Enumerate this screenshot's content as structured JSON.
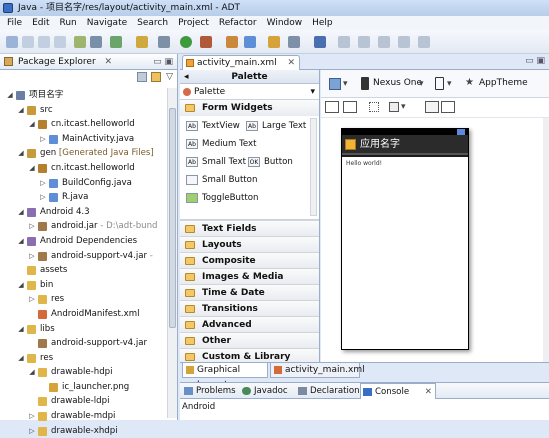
{
  "window": {
    "title": "Java - 项目名字/res/layout/activity_main.xml - ADT"
  },
  "menu": [
    "File",
    "Edit",
    "Run",
    "Navigate",
    "Search",
    "Project",
    "Refactor",
    "Window",
    "Help"
  ],
  "left": {
    "tab_label": "Package Explorer",
    "tree": [
      {
        "label": "项目名字",
        "indent": 0,
        "arrow": "◢",
        "icon": "project-icon",
        "color": "#6b7fa3"
      },
      {
        "label": "src",
        "indent": 1,
        "arrow": "◢",
        "icon": "src-folder-icon",
        "color": "#c79a3a"
      },
      {
        "label": "cn.itcast.helloworld",
        "indent": 2,
        "arrow": "◢",
        "icon": "package-icon",
        "color": "#b67f2e"
      },
      {
        "label": "MainActivity.java",
        "indent": 3,
        "arrow": "▷",
        "icon": "java-file-icon",
        "color": "#5e8ed6"
      },
      {
        "label": "gen",
        "suffix": " [Generated Java Files]",
        "indent": 1,
        "arrow": "◢",
        "icon": "gen-folder-icon",
        "color": "#c79a3a"
      },
      {
        "label": "cn.itcast.helloworld",
        "indent": 2,
        "arrow": "◢",
        "icon": "package-icon",
        "color": "#b67f2e"
      },
      {
        "label": "BuildConfig.java",
        "indent": 3,
        "arrow": "▷",
        "icon": "java-file-icon",
        "color": "#5e8ed6"
      },
      {
        "label": "R.java",
        "indent": 3,
        "arrow": "▷",
        "icon": "java-file-icon",
        "color": "#5e8ed6"
      },
      {
        "label": "Android 4.3",
        "indent": 1,
        "arrow": "◢",
        "icon": "library-icon",
        "color": "#8a6fb0"
      },
      {
        "label": "android.jar",
        "suffix": " - D:\\adt-bund",
        "indent": 2,
        "arrow": "▷",
        "icon": "jar-icon",
        "color": "#a0784a"
      },
      {
        "label": "Android Dependencies",
        "indent": 1,
        "arrow": "◢",
        "icon": "library-icon",
        "color": "#8a6fb0"
      },
      {
        "label": "android-support-v4.jar",
        "suffix": " -",
        "indent": 2,
        "arrow": "▷",
        "icon": "jar-icon",
        "color": "#a0784a"
      },
      {
        "label": "assets",
        "indent": 1,
        "arrow": "",
        "icon": "folder-icon",
        "color": "#e0b64a"
      },
      {
        "label": "bin",
        "indent": 1,
        "arrow": "◢",
        "icon": "folder-icon",
        "color": "#e0b64a"
      },
      {
        "label": "res",
        "indent": 2,
        "arrow": "▷",
        "icon": "folder-icon",
        "color": "#e0b64a"
      },
      {
        "label": "AndroidManifest.xml",
        "indent": 2,
        "arrow": "",
        "icon": "xml-file-icon",
        "color": "#d46a3a"
      },
      {
        "label": "libs",
        "indent": 1,
        "arrow": "◢",
        "icon": "folder-icon",
        "color": "#e0b64a"
      },
      {
        "label": "android-support-v4.jar",
        "indent": 2,
        "arrow": "",
        "icon": "jar-icon",
        "color": "#a0784a"
      },
      {
        "label": "res",
        "indent": 1,
        "arrow": "◢",
        "icon": "folder-icon",
        "color": "#e0b64a"
      },
      {
        "label": "drawable-hdpi",
        "indent": 2,
        "arrow": "◢",
        "icon": "folder-icon",
        "color": "#e0b64a"
      },
      {
        "label": "ic_launcher.png",
        "indent": 3,
        "arrow": "",
        "icon": "image-file-icon",
        "color": "#d6a23a"
      },
      {
        "label": "drawable-ldpi",
        "indent": 2,
        "arrow": "",
        "icon": "folder-icon",
        "color": "#e0b64a"
      },
      {
        "label": "drawable-mdpi",
        "indent": 2,
        "arrow": "▷",
        "icon": "folder-icon",
        "color": "#e0b64a"
      },
      {
        "label": "drawable-xhdpi",
        "indent": 2,
        "arrow": "▷",
        "icon": "folder-icon",
        "color": "#e0b64a"
      }
    ]
  },
  "editor": {
    "tab_label": "activity_main.xml",
    "palette_header": "Palette",
    "palette_select": "Palette",
    "open_category": "Form Widgets",
    "widgets": [
      {
        "label": "TextView",
        "icon": "Ab"
      },
      {
        "label": "Large Text",
        "icon": "Ab"
      },
      {
        "label": "Medium Text",
        "icon": "Ab"
      },
      {
        "label": "Small Text",
        "icon": "Ab"
      },
      {
        "label": "Button",
        "icon": "OK"
      },
      {
        "label": "Small Button",
        "icon": ""
      },
      {
        "label": "ToggleButton",
        "icon": ""
      }
    ],
    "categories": [
      "Text Fields",
      "Layouts",
      "Composite",
      "Images & Media",
      "Time & Date",
      "Transitions",
      "Advanced",
      "Other",
      "Custom & Library Views"
    ],
    "device": "Nexus One",
    "theme": "AppTheme",
    "preview_title": "应用名字",
    "preview_text": "Hello world!",
    "subtabs": [
      "Graphical Layout",
      "activity_main.xml"
    ]
  },
  "console": {
    "tabs": [
      "Problems",
      "Javadoc",
      "Declaration",
      "Console"
    ],
    "body": "Android"
  }
}
